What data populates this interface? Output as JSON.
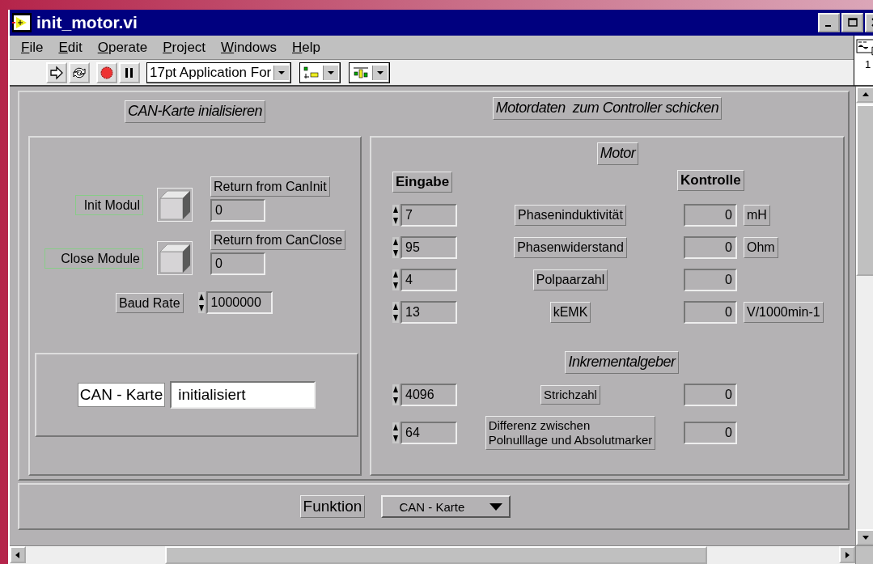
{
  "window": {
    "title": "init_motor.vi"
  },
  "menu": [
    {
      "label": "File"
    },
    {
      "label": "Edit"
    },
    {
      "label": "Operate"
    },
    {
      "label": "Project"
    },
    {
      "label": "Windows"
    },
    {
      "label": "Help"
    }
  ],
  "toolbar": {
    "font": "17pt Application For"
  },
  "connector_pane": {
    "text": "1"
  },
  "can_section": {
    "title": "CAN-Karte inialisieren",
    "modules": [
      {
        "label": "Init Modul",
        "return_label": "Return from CanInit",
        "return_value": "0"
      },
      {
        "label": "Close Module",
        "return_label": "Return from CanClose",
        "return_value": "0"
      }
    ],
    "baud_rate": {
      "label": "Baud Rate",
      "value": "1000000"
    },
    "status": {
      "label": "CAN - Karte",
      "value": "initialisiert"
    }
  },
  "motor_section": {
    "title": "Motordaten  zum Controller schicken",
    "motor": {
      "title": "Motor",
      "input_heading": "Eingabe",
      "check_heading": "Kontrolle",
      "rows": [
        {
          "input": "7",
          "name": "Phaseninduktivität",
          "reading": "0",
          "unit": "mH"
        },
        {
          "input": "95",
          "name": "Phasenwiderstand",
          "reading": "0",
          "unit": "Ohm"
        },
        {
          "input": "4",
          "name": "Polpaarzahl",
          "reading": "0"
        },
        {
          "input": "13",
          "name": "kEMK",
          "reading": "0",
          "unit": "V/1000min-1"
        }
      ]
    },
    "encoder": {
      "title": "Inkrementalgeber",
      "rows": [
        {
          "input": "4096",
          "name": "Strichzahl",
          "reading": "0"
        },
        {
          "input": "64",
          "name": "Differenz zwischen\nPolnulllage und Absolutmarker",
          "reading": "0"
        }
      ]
    }
  },
  "function": {
    "label": "Funktion",
    "value": "CAN - Karte"
  }
}
